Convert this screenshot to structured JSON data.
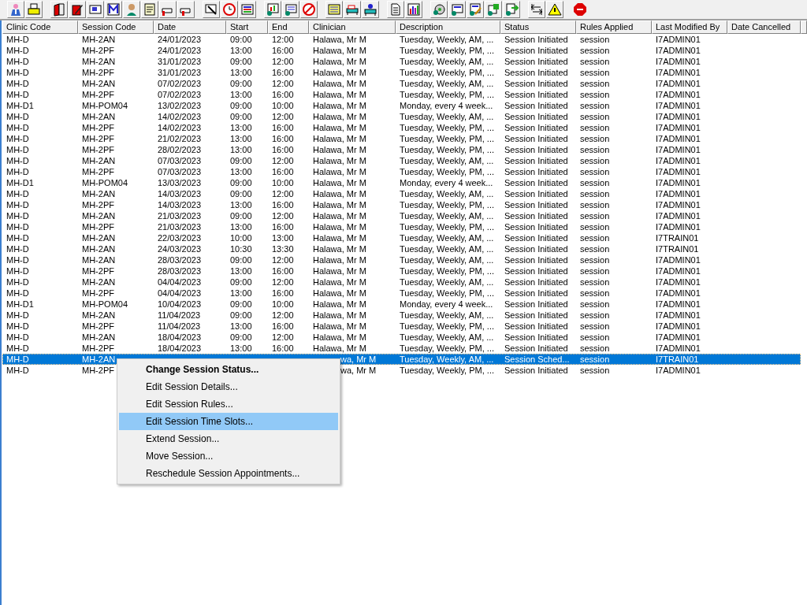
{
  "table": {
    "columns": [
      "Clinic Code",
      "Session Code",
      "Date",
      "Start",
      "End",
      "Clinician",
      "Description",
      "Status",
      "Rules Applied",
      "Last Modified By",
      "Date Cancelled"
    ],
    "rows": [
      {
        "selected": false,
        "cells": [
          "MH-D",
          "MH-2AN",
          "24/01/2023",
          "09:00",
          "12:00",
          "Halawa, Mr M",
          "Tuesday, Weekly, AM, ...",
          "Session Initiated",
          "session",
          "I7ADMIN01"
        ]
      },
      {
        "selected": false,
        "cells": [
          "MH-D",
          "MH-2PF",
          "24/01/2023",
          "13:00",
          "16:00",
          "Halawa, Mr M",
          "Tuesday, Weekly, PM, ...",
          "Session Initiated",
          "session",
          "I7ADMIN01"
        ]
      },
      {
        "selected": false,
        "cells": [
          "MH-D",
          "MH-2AN",
          "31/01/2023",
          "09:00",
          "12:00",
          "Halawa, Mr M",
          "Tuesday, Weekly, AM, ...",
          "Session Initiated",
          "session",
          "I7ADMIN01"
        ]
      },
      {
        "selected": false,
        "cells": [
          "MH-D",
          "MH-2PF",
          "31/01/2023",
          "13:00",
          "16:00",
          "Halawa, Mr M",
          "Tuesday, Weekly, PM, ...",
          "Session Initiated",
          "session",
          "I7ADMIN01"
        ]
      },
      {
        "selected": false,
        "cells": [
          "MH-D",
          "MH-2AN",
          "07/02/2023",
          "09:00",
          "12:00",
          "Halawa, Mr M",
          "Tuesday, Weekly, AM, ...",
          "Session Initiated",
          "session",
          "I7ADMIN01"
        ]
      },
      {
        "selected": false,
        "cells": [
          "MH-D",
          "MH-2PF",
          "07/02/2023",
          "13:00",
          "16:00",
          "Halawa, Mr M",
          "Tuesday, Weekly, PM, ...",
          "Session Initiated",
          "session",
          "I7ADMIN01"
        ]
      },
      {
        "selected": false,
        "cells": [
          "MH-D1",
          "MH-POM04",
          "13/02/2023",
          "09:00",
          "10:00",
          "Halawa, Mr M",
          "Monday, every 4 week...",
          "Session Initiated",
          "session",
          "I7ADMIN01"
        ]
      },
      {
        "selected": false,
        "cells": [
          "MH-D",
          "MH-2AN",
          "14/02/2023",
          "09:00",
          "12:00",
          "Halawa, Mr M",
          "Tuesday, Weekly, AM, ...",
          "Session Initiated",
          "session",
          "I7ADMIN01"
        ]
      },
      {
        "selected": false,
        "cells": [
          "MH-D",
          "MH-2PF",
          "14/02/2023",
          "13:00",
          "16:00",
          "Halawa, Mr M",
          "Tuesday, Weekly, PM, ...",
          "Session Initiated",
          "session",
          "I7ADMIN01"
        ]
      },
      {
        "selected": false,
        "cells": [
          "MH-D",
          "MH-2PF",
          "21/02/2023",
          "13:00",
          "16:00",
          "Halawa, Mr M",
          "Tuesday, Weekly, PM, ...",
          "Session Initiated",
          "session",
          "I7ADMIN01"
        ]
      },
      {
        "selected": false,
        "cells": [
          "MH-D",
          "MH-2PF",
          "28/02/2023",
          "13:00",
          "16:00",
          "Halawa, Mr M",
          "Tuesday, Weekly, PM, ...",
          "Session Initiated",
          "session",
          "I7ADMIN01"
        ]
      },
      {
        "selected": false,
        "cells": [
          "MH-D",
          "MH-2AN",
          "07/03/2023",
          "09:00",
          "12:00",
          "Halawa, Mr M",
          "Tuesday, Weekly, AM, ...",
          "Session Initiated",
          "session",
          "I7ADMIN01"
        ]
      },
      {
        "selected": false,
        "cells": [
          "MH-D",
          "MH-2PF",
          "07/03/2023",
          "13:00",
          "16:00",
          "Halawa, Mr M",
          "Tuesday, Weekly, PM, ...",
          "Session Initiated",
          "session",
          "I7ADMIN01"
        ]
      },
      {
        "selected": false,
        "cells": [
          "MH-D1",
          "MH-POM04",
          "13/03/2023",
          "09:00",
          "10:00",
          "Halawa, Mr M",
          "Monday, every 4 week...",
          "Session Initiated",
          "session",
          "I7ADMIN01"
        ]
      },
      {
        "selected": false,
        "cells": [
          "MH-D",
          "MH-2AN",
          "14/03/2023",
          "09:00",
          "12:00",
          "Halawa, Mr M",
          "Tuesday, Weekly, AM, ...",
          "Session Initiated",
          "session",
          "I7ADMIN01"
        ]
      },
      {
        "selected": false,
        "cells": [
          "MH-D",
          "MH-2PF",
          "14/03/2023",
          "13:00",
          "16:00",
          "Halawa, Mr M",
          "Tuesday, Weekly, PM, ...",
          "Session Initiated",
          "session",
          "I7ADMIN01"
        ]
      },
      {
        "selected": false,
        "cells": [
          "MH-D",
          "MH-2AN",
          "21/03/2023",
          "09:00",
          "12:00",
          "Halawa, Mr M",
          "Tuesday, Weekly, AM, ...",
          "Session Initiated",
          "session",
          "I7ADMIN01"
        ]
      },
      {
        "selected": false,
        "cells": [
          "MH-D",
          "MH-2PF",
          "21/03/2023",
          "13:00",
          "16:00",
          "Halawa, Mr M",
          "Tuesday, Weekly, PM, ...",
          "Session Initiated",
          "session",
          "I7ADMIN01"
        ]
      },
      {
        "selected": false,
        "cells": [
          "MH-D",
          "MH-2AN",
          "22/03/2023",
          "10:00",
          "13:00",
          "Halawa, Mr M",
          "Tuesday, Weekly, AM, ...",
          "Session Initiated",
          "session",
          "I7TRAIN01"
        ]
      },
      {
        "selected": false,
        "cells": [
          "MH-D",
          "MH-2AN",
          "24/03/2023",
          "10:30",
          "13:30",
          "Halawa, Mr M",
          "Tuesday, Weekly, AM, ...",
          "Session Initiated",
          "session",
          "I7TRAIN01"
        ]
      },
      {
        "selected": false,
        "cells": [
          "MH-D",
          "MH-2AN",
          "28/03/2023",
          "09:00",
          "12:00",
          "Halawa, Mr M",
          "Tuesday, Weekly, AM, ...",
          "Session Initiated",
          "session",
          "I7ADMIN01"
        ]
      },
      {
        "selected": false,
        "cells": [
          "MH-D",
          "MH-2PF",
          "28/03/2023",
          "13:00",
          "16:00",
          "Halawa, Mr M",
          "Tuesday, Weekly, PM, ...",
          "Session Initiated",
          "session",
          "I7ADMIN01"
        ]
      },
      {
        "selected": false,
        "cells": [
          "MH-D",
          "MH-2AN",
          "04/04/2023",
          "09:00",
          "12:00",
          "Halawa, Mr M",
          "Tuesday, Weekly, AM, ...",
          "Session Initiated",
          "session",
          "I7ADMIN01"
        ]
      },
      {
        "selected": false,
        "cells": [
          "MH-D",
          "MH-2PF",
          "04/04/2023",
          "13:00",
          "16:00",
          "Halawa, Mr M",
          "Tuesday, Weekly, PM, ...",
          "Session Initiated",
          "session",
          "I7ADMIN01"
        ]
      },
      {
        "selected": false,
        "cells": [
          "MH-D1",
          "MH-POM04",
          "10/04/2023",
          "09:00",
          "10:00",
          "Halawa, Mr M",
          "Monday, every 4 week...",
          "Session Initiated",
          "session",
          "I7ADMIN01"
        ]
      },
      {
        "selected": false,
        "cells": [
          "MH-D",
          "MH-2AN",
          "11/04/2023",
          "09:00",
          "12:00",
          "Halawa, Mr M",
          "Tuesday, Weekly, AM, ...",
          "Session Initiated",
          "session",
          "I7ADMIN01"
        ]
      },
      {
        "selected": false,
        "cells": [
          "MH-D",
          "MH-2PF",
          "11/04/2023",
          "13:00",
          "16:00",
          "Halawa, Mr M",
          "Tuesday, Weekly, PM, ...",
          "Session Initiated",
          "session",
          "I7ADMIN01"
        ]
      },
      {
        "selected": false,
        "cells": [
          "MH-D",
          "MH-2AN",
          "18/04/2023",
          "09:00",
          "12:00",
          "Halawa, Mr M",
          "Tuesday, Weekly, AM, ...",
          "Session Initiated",
          "session",
          "I7ADMIN01"
        ]
      },
      {
        "selected": false,
        "cells": [
          "MH-D",
          "MH-2PF",
          "18/04/2023",
          "13:00",
          "16:00",
          "Halawa, Mr M",
          "Tuesday, Weekly, PM, ...",
          "Session Initiated",
          "session",
          "I7ADMIN01"
        ]
      },
      {
        "selected": true,
        "cells": [
          "MH-D",
          "MH-2AN",
          null,
          null,
          null,
          "wa, Mr M",
          "Tuesday, Weekly, AM, ...",
          "Session Sched...",
          "session",
          "I7TRAIN01"
        ]
      },
      {
        "selected": false,
        "cells": [
          "MH-D",
          "MH-2PF",
          null,
          null,
          null,
          "wa, Mr M",
          "Tuesday, Weekly, PM, ...",
          "Session Initiated",
          "session",
          "I7ADMIN01"
        ]
      }
    ]
  },
  "context_menu": {
    "items": [
      {
        "label": "Change Session Status...",
        "default": true,
        "selected": false
      },
      {
        "label": "Edit Session Details...",
        "default": false,
        "selected": false
      },
      {
        "label": "Edit Session Rules...",
        "default": false,
        "selected": false
      },
      {
        "label": "Edit Session Time Slots...",
        "default": false,
        "selected": true
      },
      {
        "label": "Extend Session...",
        "default": false,
        "selected": false
      },
      {
        "label": "Move Session...",
        "default": false,
        "selected": false
      },
      {
        "label": "Reschedule Session Appointments...",
        "default": false,
        "selected": false
      }
    ]
  }
}
